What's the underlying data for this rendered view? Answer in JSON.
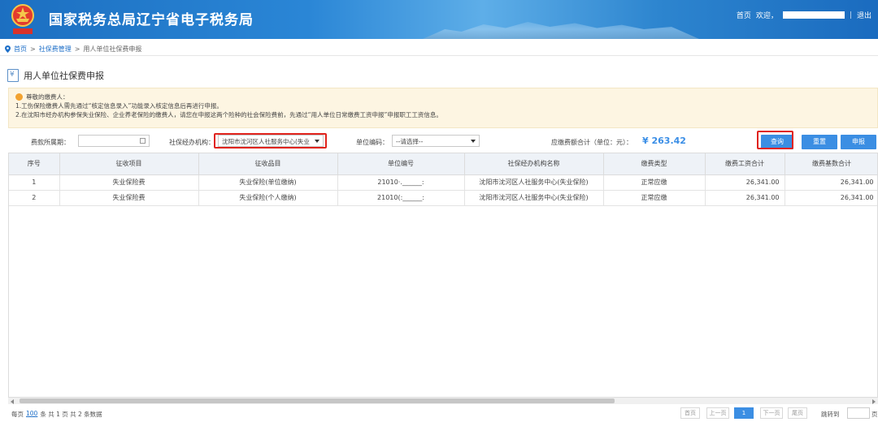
{
  "header": {
    "site_title": "国家税务总局辽宁省电子税务局",
    "home_link": "首页",
    "welcome": "欢迎，",
    "separator": "|",
    "logout": "退出"
  },
  "breadcrumb": [
    "首页",
    ">",
    "社保费管理",
    ">",
    "用人单位社保费申报"
  ],
  "page_title": "用人单位社保费申报",
  "notice": {
    "greeting": "尊敬的缴费人：",
    "line1": "1.工伤保险缴费人需先通过“核定信息录入”功能录入核定信息后再进行申报。",
    "line2": "2.在沈阳市经办机构参保失业保险、企业养老保险的缴费人，请您在申报这两个险种的社会保险费前，先通过“用人单位日常缴费工资申报”申报职工工资信息。"
  },
  "filters": {
    "period_label": "费款所属期：",
    "period_value": "",
    "agency_label": "社保经办机构：",
    "agency_value": "沈阳市沈河区人社服务中心(失业",
    "unit_code_label": "单位编码：",
    "unit_code_value": "--请选择--",
    "total_label": "应缴费额合计（单位：元）：",
    "total_value": "¥ 263.42"
  },
  "buttons": {
    "query": "查询",
    "reset": "重置",
    "declare": "申报"
  },
  "table": {
    "headers": [
      "序号",
      "征收项目",
      "征收品目",
      "单位编号",
      "社保经办机构名称",
      "缴费类型",
      "缴费工资合计",
      "缴费基数合计"
    ],
    "rows": [
      [
        "1",
        "失业保险费",
        "失业保险(单位缴纳)",
        "21010·.______:",
        "沈阳市沈河区人社服务中心(失业保险)",
        "正常应缴",
        "26,341.00",
        "26,341.00"
      ],
      [
        "2",
        "失业保险费",
        "失业保险(个人缴纳)",
        "21010(:______:",
        "沈阳市沈河区人社服务中心(失业保险)",
        "正常应缴",
        "26,341.00",
        "26,341.00"
      ]
    ]
  },
  "pager": {
    "per_page_prefix": "每页",
    "per_page": "100",
    "summary": "条 共 1 页   共 2 条数据",
    "first": "首页",
    "prev": "上一页",
    "current": "1",
    "next": "下一页",
    "last": "尾页",
    "jump_label": "跳转到",
    "jump_unit": "页"
  },
  "colors": {
    "header_blue": "#2a86d6",
    "button_blue": "#3b8ee3",
    "highlight_red": "#e0231c",
    "total_blue": "#3a8ee6",
    "notice_bg": "#fdf5e2"
  },
  "icons": {
    "emblem": "tax-emblem-icon",
    "breadcrumb": "location-pin-icon",
    "page": "tax-doc-icon",
    "notice": "warning-icon",
    "calendar": "calendar-icon"
  }
}
